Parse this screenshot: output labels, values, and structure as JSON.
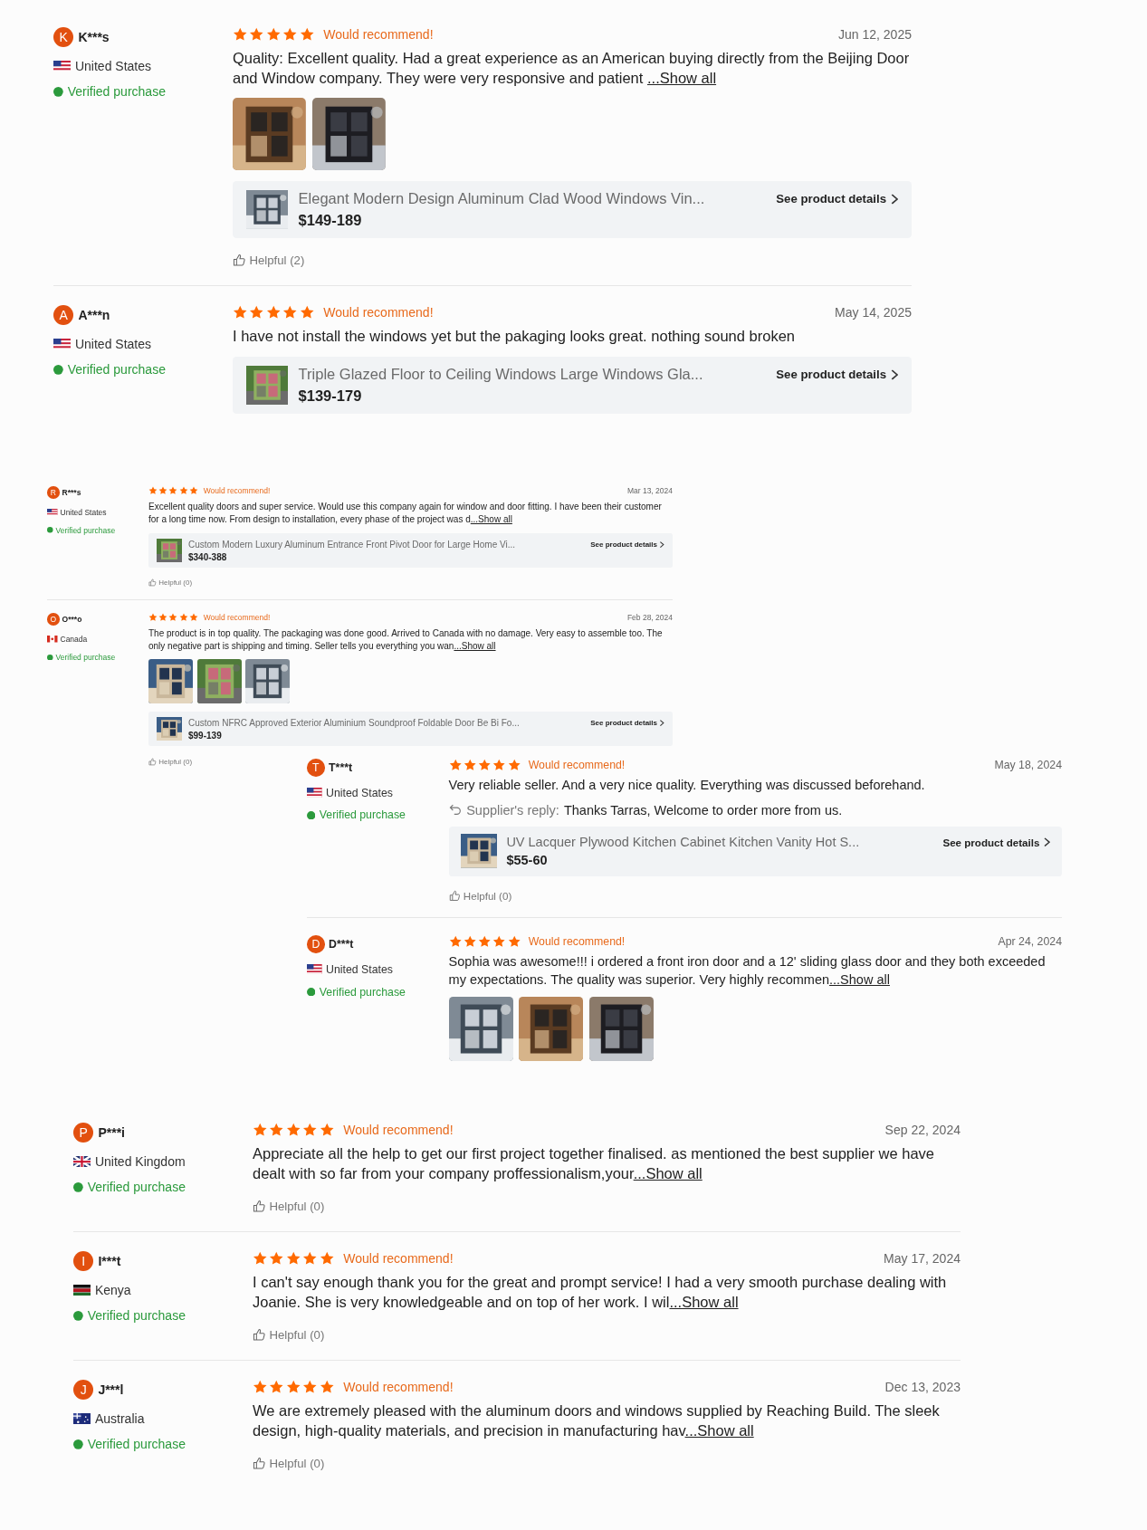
{
  "panels": [
    {
      "kind": "large",
      "reviews": [
        {
          "avatar": "K",
          "name": "K***s",
          "flag": {
            "kind": "us"
          },
          "country": "United States",
          "verified": "Verified purchase",
          "stars": 5,
          "recommend": "Would recommend!",
          "date": "Jun 12, 2025",
          "text": "Quality: Excellent quality. Had a great experience as an American buying directly from the Beijing Door and Window company. They were very responsive and patient ",
          "more": "...Show all",
          "photos": [
            {
              "kind": "picture"
            },
            {
              "kind": "picture"
            }
          ],
          "product": {
            "title": "Elegant Modern Design Aluminum Clad Wood Windows Vin...",
            "price": "$149-189",
            "link": "See product details"
          },
          "helpful": "Helpful (2)"
        },
        {
          "avatar": "A",
          "name": "A***n",
          "flag": {
            "kind": "us"
          },
          "country": "United States",
          "verified": "Verified purchase",
          "stars": 5,
          "recommend": "Would recommend!",
          "date": "May 14, 2025",
          "text": "I have not install the windows yet but the pakaging looks great. nothing sound broken",
          "product": {
            "title": "Triple Glazed Floor to Ceiling Windows Large Windows Gla...",
            "price": "$139-179",
            "link": "See product details"
          }
        }
      ]
    },
    {
      "kind": "small",
      "reviews": [
        {
          "avatar": "R",
          "name": "R***s",
          "flag": {
            "kind": "us"
          },
          "country": "United States",
          "verified": "Verified purchase",
          "stars": 5,
          "recommend": "Would recommend!",
          "date": "Mar 13, 2024",
          "text": "Excellent quality doors and super service. Would use this company again for window and door fitting. I have been their customer for a long time now. From design to installation, every phase of the project was d",
          "more": "...Show all",
          "product": {
            "title": "Custom Modern Luxury Aluminum Entrance Front Pivot Door for Large Home Vi...",
            "price": "$340-388",
            "link": "See product details"
          },
          "helpful": "Helpful (0)"
        },
        {
          "avatar": "O",
          "name": "O***o",
          "flag": {
            "kind": "ca"
          },
          "country": "Canada",
          "verified": "Verified purchase",
          "stars": 5,
          "recommend": "Would recommend!",
          "date": "Feb 28, 2024",
          "text": "The product is in top quality. The packaging was done good. Arrived to Canada with no damage. Very easy to assemble too. The only negative part is shipping and timing. Seller tells you everything you wan",
          "more": "...Show all",
          "photos": [
            {
              "kind": "picture"
            },
            {
              "kind": "picture"
            },
            {
              "kind": "picture"
            }
          ],
          "product": {
            "title": "Custom NFRC Approved Exterior Aluminium Soundproof Foldable Door Be Bi Fo...",
            "price": "$99-139",
            "link": "See product details"
          },
          "helpful": "Helpful (0)"
        }
      ]
    },
    {
      "kind": "medium",
      "reviews": [
        {
          "avatar": "T",
          "name": "T***t",
          "flag": {
            "kind": "us"
          },
          "country": "United States",
          "verified": "Verified purchase",
          "stars": 5,
          "recommend": "Would recommend!",
          "date": "May 18, 2024",
          "text": "Very reliable seller. And a very nice quality. Everything was discussed beforehand.",
          "reply": {
            "label": "Supplier's reply:",
            "text": "Thanks Tarras, Welcome to order more from us."
          },
          "product": {
            "title": "UV Lacquer Plywood Kitchen Cabinet Kitchen Vanity Hot S...",
            "price": "$55-60",
            "link": "See product details"
          },
          "helpful": "Helpful (0)"
        },
        {
          "avatar": "D",
          "name": "D***t",
          "flag": {
            "kind": "us"
          },
          "country": "United States",
          "verified": "Verified purchase",
          "stars": 5,
          "recommend": "Would recommend!",
          "date": "Apr 24, 2024",
          "text": "Sophia was awesome!!! i ordered a front iron door and a 12' sliding glass door and they both exceeded my expectations. The quality was superior. Very highly recommen",
          "more": "...Show all",
          "photos": [
            {
              "kind": "picture"
            },
            {
              "kind": "picture"
            },
            {
              "kind": "picture"
            }
          ]
        }
      ]
    },
    {
      "kind": "large",
      "reviews": [
        {
          "avatar": "P",
          "name": "P***i",
          "flag": {
            "kind": "uk"
          },
          "country": "United Kingdom",
          "verified": "Verified purchase",
          "stars": 5,
          "recommend": "Would recommend!",
          "date": "Sep 22, 2024",
          "text": "Appreciate all the help to get our first project together finalised. as mentioned the best supplier we have dealt with so far from your company proffessionalism,your",
          "more": "...Show all",
          "helpful": "Helpful (0)"
        },
        {
          "avatar": "I",
          "name": "I***t",
          "flag": {
            "kind": "ke"
          },
          "country": "Kenya",
          "verified": "Verified purchase",
          "stars": 5,
          "recommend": "Would recommend!",
          "date": "May 17, 2024",
          "text": "I can't say enough thank you for the great and prompt service! I had a very smooth purchase dealing with Joanie. She is very knowledgeable and on top of her work. I wil",
          "more": "...Show all",
          "helpful": "Helpful (0)"
        },
        {
          "avatar": "J",
          "name": "J***l",
          "flag": {
            "kind": "au"
          },
          "country": "Australia",
          "verified": "Verified purchase",
          "stars": 5,
          "recommend": "Would recommend!",
          "date": "Dec 13, 2023",
          "text": "We are extremely pleased with the aluminum doors and windows supplied by Reaching Build. The sleek design, high-quality materials, and precision in manufacturing hav",
          "more": "...Show all",
          "helpful": "Helpful (0)"
        }
      ]
    }
  ]
}
